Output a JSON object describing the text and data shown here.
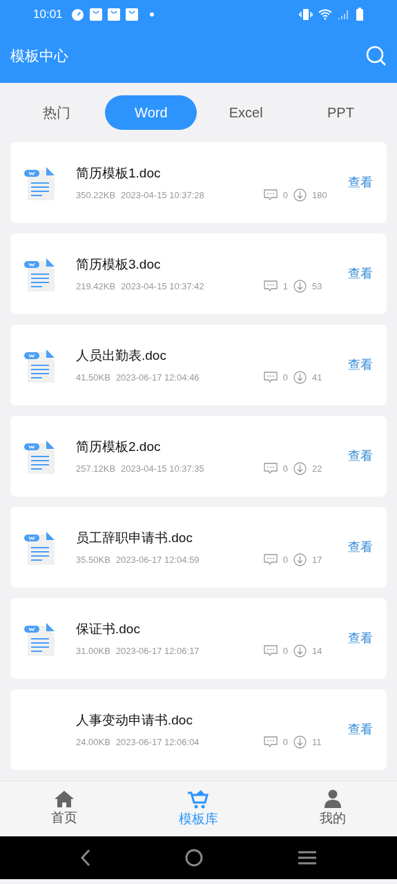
{
  "status_bar": {
    "time": "10:01"
  },
  "app_bar": {
    "title": "模板中心"
  },
  "tabs": [
    {
      "label": "热门",
      "selected": false
    },
    {
      "label": "Word",
      "selected": true
    },
    {
      "label": "Excel",
      "selected": false
    },
    {
      "label": "PPT",
      "selected": false
    }
  ],
  "files": [
    {
      "name": "简历模板1.doc",
      "size": "350.22KB",
      "date": "2023-04-15 10:37:28",
      "comments": "0",
      "downloads": "180",
      "action": "查看",
      "icon_loaded": true
    },
    {
      "name": "简历模板3.doc",
      "size": "219.42KB",
      "date": "2023-04-15 10:37:42",
      "comments": "1",
      "downloads": "53",
      "action": "查看",
      "icon_loaded": true
    },
    {
      "name": "人员出勤表.doc",
      "size": "41.50KB",
      "date": "2023-06-17 12:04:46",
      "comments": "0",
      "downloads": "41",
      "action": "查看",
      "icon_loaded": true
    },
    {
      "name": "简历模板2.doc",
      "size": "257.12KB",
      "date": "2023-04-15 10:37:35",
      "comments": "0",
      "downloads": "22",
      "action": "查看",
      "icon_loaded": true
    },
    {
      "name": "员工辞职申请书.doc",
      "size": "35.50KB",
      "date": "2023-06-17 12:04:59",
      "comments": "0",
      "downloads": "17",
      "action": "查看",
      "icon_loaded": true
    },
    {
      "name": "保证书.doc",
      "size": "31.00KB",
      "date": "2023-06-17 12:06:17",
      "comments": "0",
      "downloads": "14",
      "action": "查看",
      "icon_loaded": true
    },
    {
      "name": "人事变动申请书.doc",
      "size": "24.00KB",
      "date": "2023-06-17 12:06:04",
      "comments": "0",
      "downloads": "11",
      "action": "查看",
      "icon_loaded": false
    }
  ],
  "bottom_nav": [
    {
      "label": "首页",
      "kind": "home",
      "selected": false
    },
    {
      "label": "模板库",
      "kind": "cart",
      "selected": true
    },
    {
      "label": "我的",
      "kind": "person",
      "selected": false
    }
  ]
}
